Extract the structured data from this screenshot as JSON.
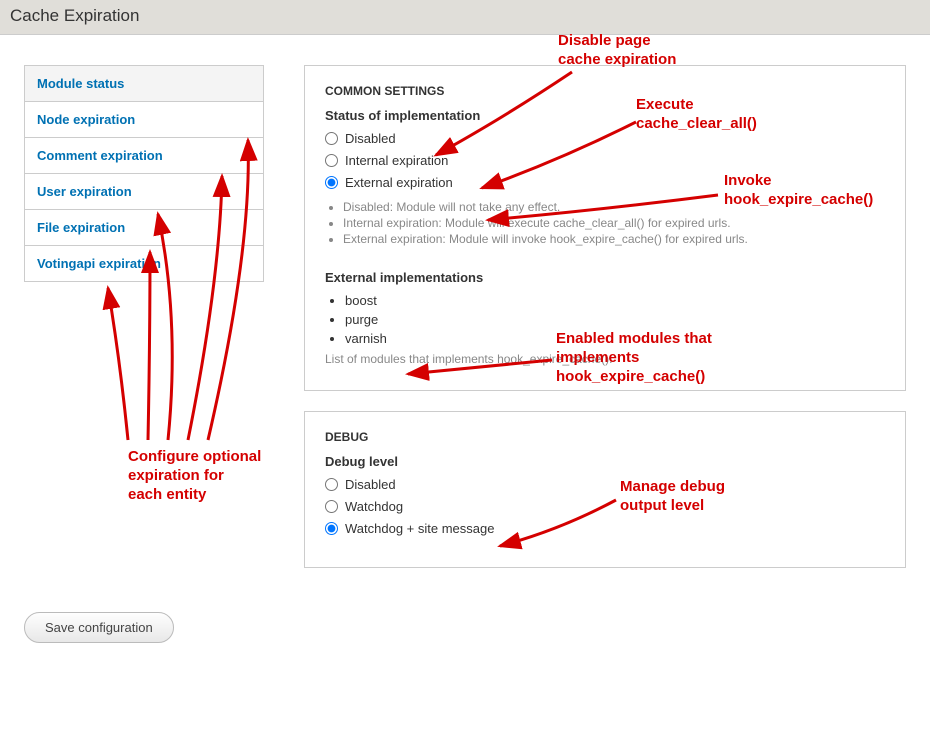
{
  "header": {
    "title": "Cache Expiration"
  },
  "sidebar": {
    "items": [
      {
        "label": "Module status"
      },
      {
        "label": "Node expiration"
      },
      {
        "label": "Comment expiration"
      },
      {
        "label": "User expiration"
      },
      {
        "label": "File expiration"
      },
      {
        "label": "Votingapi expiration"
      }
    ]
  },
  "common": {
    "section": "COMMON SETTINGS",
    "status_label": "Status of implementation",
    "status_options": {
      "disabled": "Disabled",
      "internal": "Internal expiration",
      "external": "External expiration"
    },
    "status_selected": "external",
    "status_descriptions": [
      "Disabled: Module will not take any effect.",
      "Internal expiration: Module will execute cache_clear_all() for expired urls.",
      "External expiration: Module will invoke hook_expire_cache() for expired urls."
    ],
    "ext_label": "External implementations",
    "ext_items": [
      "boost",
      "purge",
      "varnish"
    ],
    "ext_hint": "List of modules that implements hook_expire_cache()."
  },
  "debug": {
    "section": "DEBUG",
    "label": "Debug level",
    "options": {
      "disabled": "Disabled",
      "watchdog": "Watchdog",
      "watchdog_site": "Watchdog + site message"
    },
    "selected": "watchdog_site"
  },
  "buttons": {
    "save": "Save configuration"
  },
  "annotations": {
    "disable_page": "Disable page\ncache expiration",
    "execute": "Execute\ncache_clear_all()",
    "invoke": "Invoke\nhook_expire_cache()",
    "enabled_modules": "Enabled modules that\nimplements\nhook_expire_cache()",
    "configure_each": "Configure optional\nexpiration for\neach entity",
    "manage_debug": "Manage debug\noutput level"
  }
}
